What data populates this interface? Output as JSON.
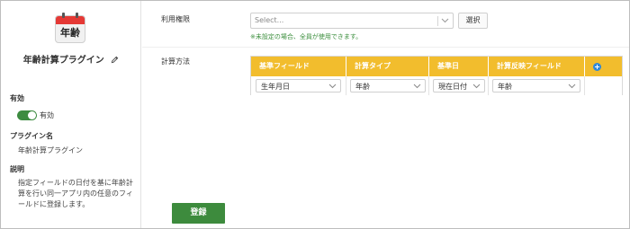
{
  "sidebar": {
    "icon_text": "年齢",
    "plugin_name": "年齢計算プラグイン",
    "enabled_label": "有効",
    "enabled_value": "有効",
    "plugin_name_label": "プラグイン名",
    "plugin_name_value": "年齢計算プラグイン",
    "description_label": "説明",
    "description_value": "指定フィールドの日付を基に年齢計算を行い同一アプリ内の任意のフィールドに登録します。"
  },
  "permission": {
    "label": "利用権限",
    "placeholder": "Select...",
    "choose_button": "選択",
    "note": "※未設定の場合、全員が使用できます。"
  },
  "calculation": {
    "label": "計算方法",
    "headers": [
      "基準フィールド",
      "計算タイプ",
      "基準日",
      "計算反映フィールド"
    ],
    "row": [
      "生年月日",
      "年齢",
      "現在日付",
      "年齢"
    ]
  },
  "save_button": "登録",
  "colors": {
    "accent_green": "#3d8b3d",
    "header_yellow": "#f2bd2d",
    "add_blue": "#2f88d8",
    "calendar_red": "#e53935"
  }
}
